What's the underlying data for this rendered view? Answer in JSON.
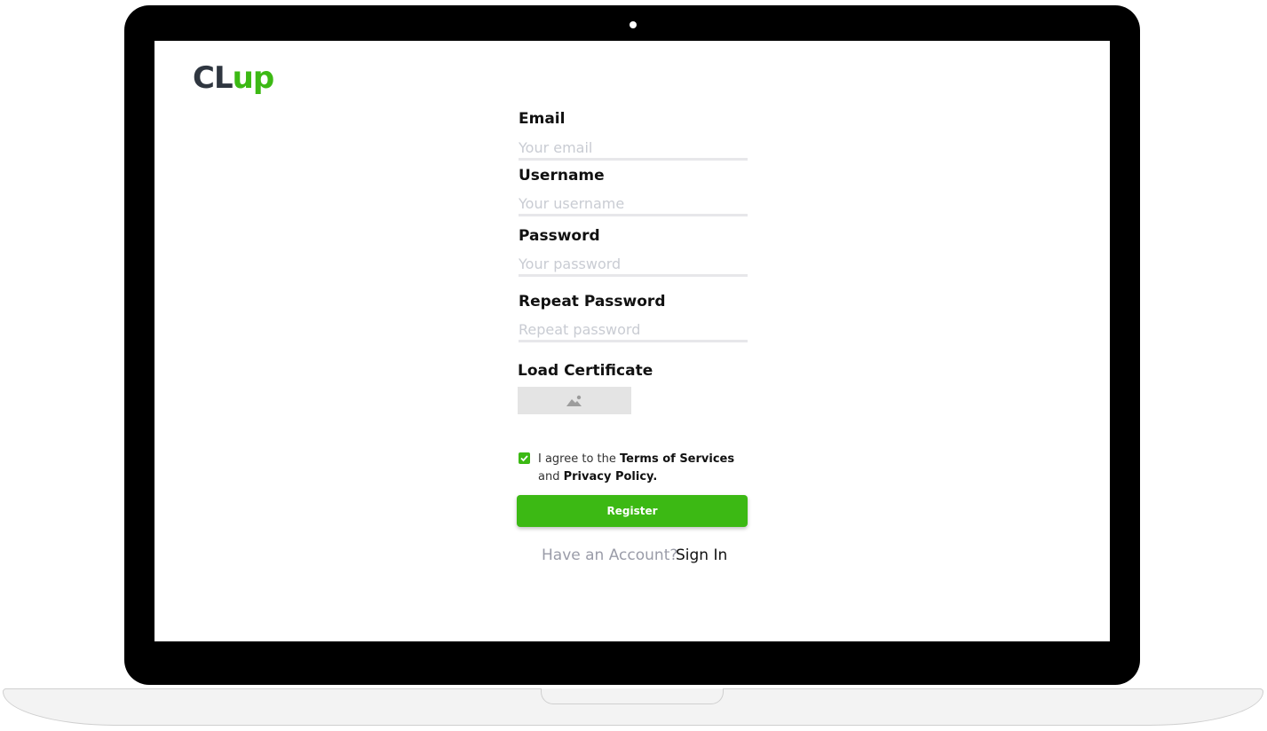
{
  "brand": {
    "part1": "CL",
    "part2": "up",
    "color_dark": "#2f3640",
    "color_accent": "#3cb914"
  },
  "form": {
    "email_label": "Email",
    "email_placeholder": "Your email",
    "username_label": "Username",
    "username_placeholder": "Your username",
    "password_label": "Password",
    "password_placeholder": "Your password",
    "repeat_label": "Repeat Password",
    "repeat_placeholder": "Repeat password",
    "certificate_label": "Load Certificate",
    "certificate_icon": "image-upload-icon"
  },
  "agreement": {
    "checked": true,
    "prefix": "I agree to the",
    "terms": "Terms of Services",
    "middle": "and",
    "privacy": "Privacy Policy."
  },
  "register_label": "Register",
  "footer": {
    "question": "Have an Account?",
    "signin_label": "Sign In"
  }
}
